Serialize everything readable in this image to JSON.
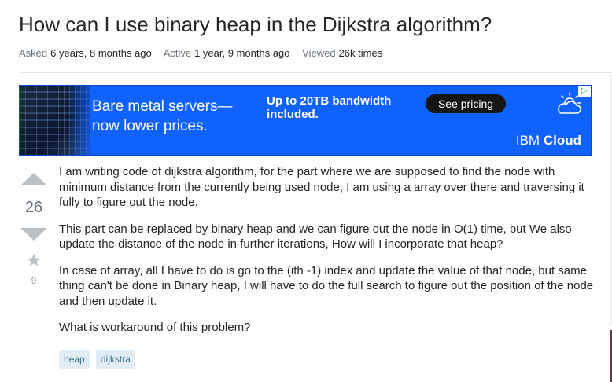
{
  "question": {
    "title": "How can I use binary heap in the Dijkstra algorithm?",
    "meta": {
      "asked_label": "Asked",
      "asked_value": "6 years, 8 months ago",
      "active_label": "Active",
      "active_value": "1 year, 9 months ago",
      "viewed_label": "Viewed",
      "viewed_value": "26k times"
    },
    "votes": {
      "score": "26",
      "favorites": "9"
    },
    "body": [
      "I am writing code of dijkstra algorithm, for the part where we are supposed to find the node with minimum distance from the currently being used node, I am using a array over there and traversing it fully to figure out the node.",
      "This part can be replaced by binary heap and we can figure out the node in O(1) time, but We also update the distance of the node in further iterations, How will I incorporate that heap?",
      "In case of array, all I have to do is go to the (ith -1) index and update the value of that node, but same thing can't be done in Binary heap, I will have to do the full search to figure out the position of the node and then update it.",
      "What is workaround of this problem?"
    ],
    "tags": [
      "heap",
      "dijkstra"
    ]
  },
  "ad": {
    "headline_line1": "Bare metal servers—",
    "headline_line2": "now lower prices.",
    "subtext": "Up to 20TB bandwidth included.",
    "cta": "See pricing",
    "brand_light": "IBM",
    "brand_bold": "Cloud",
    "choices_icon": "adchoices-icon",
    "cloud_icon": "cloud-sun-icon",
    "background_color": "#0f62fe"
  },
  "colors": {
    "title": "#242729",
    "meta": "#6a737c",
    "tag_bg": "#e1ecf4",
    "tag_text": "#39739d",
    "vote_arrow": "#bbc0c4"
  }
}
